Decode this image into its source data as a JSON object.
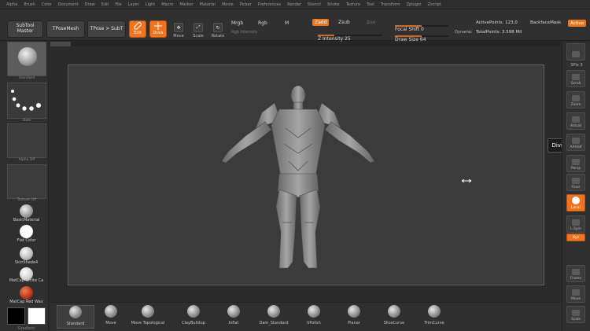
{
  "menu": [
    "Alpha",
    "Brush",
    "Color",
    "Document",
    "Draw",
    "Edit",
    "File",
    "Layer",
    "Light",
    "Macro",
    "Marker",
    "Material",
    "Movie",
    "Picker",
    "Preferences",
    "Render",
    "Stencil",
    "Stroke",
    "Texture",
    "Tool",
    "Transform",
    "Zplugin",
    "Zscript"
  ],
  "toolbar": {
    "subtool_master": "SubTool Master",
    "tpose_mesh": "TPoseMesh",
    "tpose_subt": "TPose > SubT",
    "edit": "Edit",
    "draw": "Draw",
    "move": "Move",
    "scale": "Scale",
    "rotate": "Rotate",
    "mrgb": "Mrgb",
    "rgb": "Rgb",
    "m": "M",
    "rgb_intensity": "Rgb Intensity",
    "zadd": "Zadd",
    "zsub": "Zsub",
    "zcut": "Zcut",
    "z_intensity": "Z Intensity 25",
    "z_intensity_value": 25,
    "focal_shift": "Focal Shift 0",
    "focal_shift_value": 0,
    "draw_size": "Draw Size 64",
    "draw_size_value": 64,
    "dynamic": "Dynamic",
    "active_points": "ActivePoints: 123,0",
    "total_points": "TotalPoints: 3.598 Mil",
    "backface": "BackfaceMask",
    "active": "Active",
    "accent": "#f0731f"
  },
  "left": {
    "brush_label": "Standard",
    "stroke_label": "Dots",
    "alpha_label": "Alpha Off",
    "texture_label": "Texture Off",
    "materials": [
      {
        "label": "BasicMaterial"
      },
      {
        "label": "Flat Color"
      },
      {
        "label": "SkinShade4"
      },
      {
        "label": "MatCap White Ca"
      },
      {
        "label": "MatCap Red Wax"
      }
    ],
    "color_primary": "#000000",
    "color_secondary": "#ffffff",
    "grad_label": "Gradient"
  },
  "right": {
    "spix": "SPix 3",
    "buttons": [
      "BPR",
      "Scroll",
      "Zoom",
      "Actual",
      "AAHalf",
      "Persp",
      "Floor",
      "Local",
      "L.Sym",
      "Xyz",
      "Frame",
      "Move",
      "Scale"
    ]
  },
  "divider_tooltip": "Divider",
  "brushes": [
    "Standard",
    "Move",
    "Move Topological",
    "ClayBuildup",
    "Inflat",
    "Dam_Standard",
    "hPolish",
    "Planar",
    "SliceCurve",
    "TrimCurve"
  ]
}
